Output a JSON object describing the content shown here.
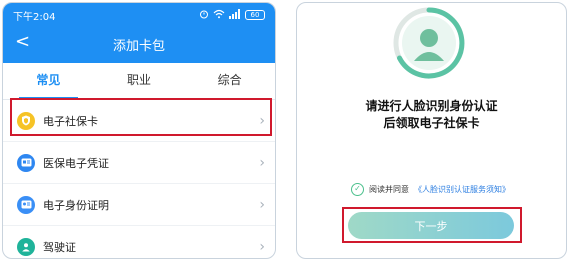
{
  "left_screen": {
    "status": {
      "time": "下午2:04",
      "battery": "60"
    },
    "nav": {
      "back_symbol": "<",
      "title": "添加卡包"
    },
    "tabs": [
      {
        "label": "常见",
        "active": true
      },
      {
        "label": "职业",
        "active": false
      },
      {
        "label": "综合",
        "active": false
      }
    ],
    "items": [
      {
        "label": "电子社保卡",
        "icon": "shield-card-icon",
        "highlighted": true
      },
      {
        "label": "医保电子凭证",
        "icon": "medical-card-icon",
        "highlighted": false
      },
      {
        "label": "电子身份证明",
        "icon": "id-card-icon",
        "highlighted": false
      },
      {
        "label": "驾驶证",
        "icon": "driver-license-icon",
        "highlighted": false
      }
    ],
    "chevron": "›",
    "colors": {
      "header": "#1e8ff3",
      "highlight": "#d0192d"
    }
  },
  "right_screen": {
    "prompt": {
      "line1": "请进行人脸识别身份认证",
      "line2": "后领取电子社保卡"
    },
    "agree": {
      "prefix": "阅读并同意",
      "link": "《人脸识别认证服务须知》"
    },
    "next_button": "下一步",
    "colors": {
      "button_start": "#9fd9c7",
      "button_end": "#7cc9dc",
      "accent": "#4cc08d",
      "highlight": "#d0192d"
    }
  }
}
